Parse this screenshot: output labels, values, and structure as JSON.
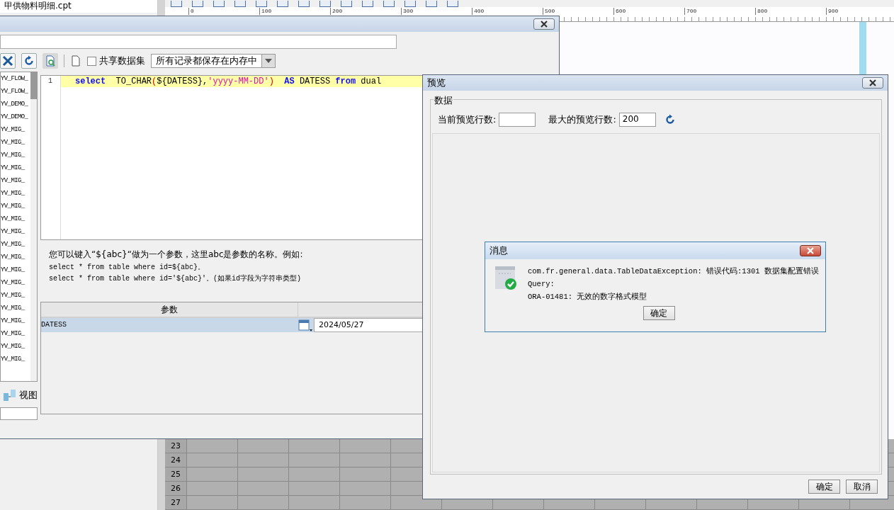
{
  "file_tab": {
    "label": "甲供物料明细.cpt"
  },
  "ruler": {
    "labels": [
      "0",
      "100",
      "200",
      "300",
      "400",
      "500",
      "600",
      "700",
      "800",
      "900"
    ]
  },
  "sheet": {
    "row_numbers": [
      "23",
      "24",
      "25",
      "26",
      "27"
    ]
  },
  "dataset_dialog": {
    "shared_checkbox": {
      "label": "共享数据集",
      "checked": false
    },
    "storage_dropdown": {
      "value": "所有记录都保存在内存中"
    },
    "tables": [
      {
        "label": "YV_FLOW_"
      },
      {
        "label": "YV_FLOW_"
      },
      {
        "label": "YV_DEMO_"
      },
      {
        "label": "YV_DEMO_"
      },
      {
        "label": "YV_MIG_"
      },
      {
        "label": "YV_MIG_"
      },
      {
        "label": "YV_MIG_"
      },
      {
        "label": "YV_MIG_"
      },
      {
        "label": "YV_MIG_"
      },
      {
        "label": "YV_MIG_"
      },
      {
        "label": "YV_MIG_"
      },
      {
        "label": "YV_MIG_"
      },
      {
        "label": "YV_MIG_"
      },
      {
        "label": "YV_MIG_"
      },
      {
        "label": "YV_MIG_"
      },
      {
        "label": "YV_MIG_"
      },
      {
        "label": "YV_MIG_"
      },
      {
        "label": "YV_MIG_"
      },
      {
        "label": "YV_MIG_"
      },
      {
        "label": "YV_MIG_"
      },
      {
        "label": "YV_MIG_"
      },
      {
        "label": "YV_MIG_"
      },
      {
        "label": "YV_MIG_"
      }
    ],
    "views_label": "视图",
    "editor": {
      "line_number": "1",
      "tokens": [
        {
          "kind": "keyword",
          "text": "select"
        },
        {
          "kind": "plain",
          "text": "  TO_CHAR"
        },
        {
          "kind": "paren",
          "text": "("
        },
        {
          "kind": "plain",
          "text": "${DATESS},"
        },
        {
          "kind": "string",
          "text": "'yyyy-MM-DD'"
        },
        {
          "kind": "paren",
          "text": ")"
        },
        {
          "kind": "keyword",
          "text": "  AS"
        },
        {
          "kind": "plain",
          "text": " DATESS "
        },
        {
          "kind": "keyword",
          "text": "from"
        },
        {
          "kind": "plain",
          "text": " dual"
        }
      ]
    },
    "hint_lines": [
      "您可以键入“${abc}“做为一个参数，这里abc是参数的名称。例如:",
      "select * from table where id=${abc}。",
      "select * from table where id='${abc}'。(如果id字段为字符串类型)"
    ],
    "parameters": {
      "column": "参数",
      "rows": [
        {
          "name": "DATESS",
          "value": "2024/05/27",
          "selected": true
        }
      ]
    }
  },
  "preview_dialog": {
    "title": "预览",
    "group_label": "数据",
    "current_rows_label": "当前预览行数:",
    "max_rows_label": "最大的预览行数:",
    "max_rows_value": "200",
    "buttons": [
      "确定",
      "取消"
    ]
  },
  "message_dialog": {
    "title": "消息",
    "lines": [
      "com.fr.general.data.TableDataException: 错误代码:1301 数据集配置错误",
      "Query:",
      "ORA-01481: 无效的数字格式模型"
    ],
    "button": "确定"
  }
}
